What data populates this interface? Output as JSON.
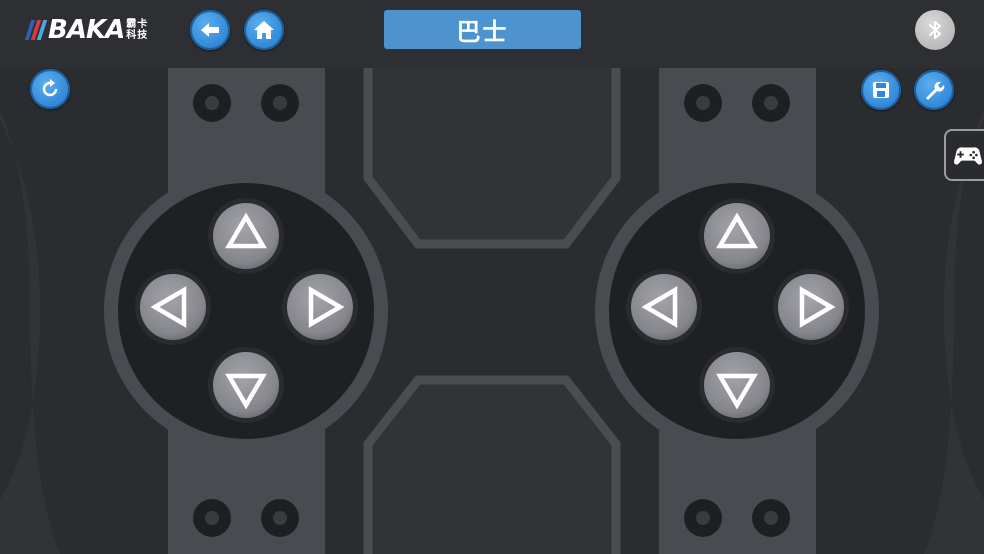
{
  "header": {
    "logo_text": "BAKA",
    "logo_cn_line1": "霸卡",
    "logo_cn_line2": "科技",
    "title": "巴士"
  },
  "colors": {
    "accent_blue": "#3a8ee0",
    "title_bg": "#4d93cf",
    "logo_bar_1": "#2b5fb8",
    "logo_bar_2": "#d63b3b",
    "logo_bar_3": "#4aa8e8",
    "pad_button": "#8a8b91"
  },
  "icons": {
    "back": "arrow-left-icon",
    "home": "home-icon",
    "bluetooth": "bluetooth-icon",
    "refresh": "refresh-icon",
    "save": "floppy-disk-icon",
    "settings": "wrench-icon",
    "gamepad_mode": "gamepad-icon"
  },
  "left_dpad": {
    "up": "up",
    "down": "down",
    "left": "left",
    "right": "right"
  },
  "right_dpad": {
    "up": "up",
    "down": "down",
    "left": "left",
    "right": "right"
  }
}
